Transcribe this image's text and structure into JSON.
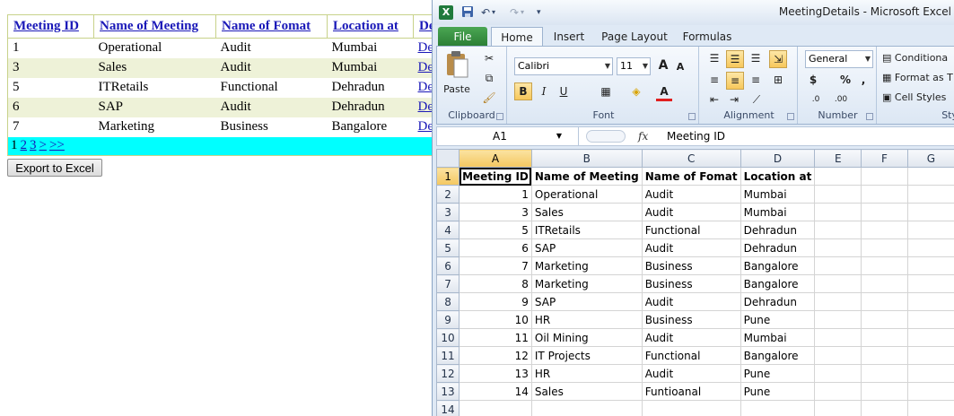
{
  "web": {
    "columns": [
      "Meeting ID",
      "Name of Meeting",
      "Name of Fomat",
      "Location at",
      "De"
    ],
    "rows": [
      {
        "id": "1",
        "name": "Operational",
        "format": "Audit",
        "location": "Mumbai",
        "more": "De"
      },
      {
        "id": "3",
        "name": "Sales",
        "format": "Audit",
        "location": "Mumbai",
        "more": "De"
      },
      {
        "id": "5",
        "name": "ITRetails",
        "format": "Functional",
        "location": "Dehradun",
        "more": "De"
      },
      {
        "id": "6",
        "name": "SAP",
        "format": "Audit",
        "location": "Dehradun",
        "more": "De"
      },
      {
        "id": "7",
        "name": "Marketing",
        "format": "Business",
        "location": "Bangalore",
        "more": "De"
      }
    ],
    "pager": {
      "current": "1",
      "pages": [
        "2",
        "3"
      ],
      "next": ">",
      "last": ">>"
    },
    "export_label": "Export to Excel"
  },
  "excel": {
    "window_title": "MeetingDetails  -  Microsoft Excel",
    "qat": {
      "save_icon": "save-icon",
      "undo_icon": "undo-icon",
      "redo_icon": "redo-icon"
    },
    "tabs": [
      "File",
      "Home",
      "Insert",
      "Page Layout",
      "Formulas"
    ],
    "ribbon": {
      "clipboard": {
        "label": "Clipboard",
        "paste": "Paste"
      },
      "font": {
        "label": "Font",
        "name": "Calibri",
        "size": "11",
        "bold": "B",
        "italic": "I",
        "underline": "U",
        "grow": "A",
        "shrink": "A"
      },
      "alignment": {
        "label": "Alignment"
      },
      "number": {
        "label": "Number",
        "format": "General",
        "currency": "$",
        "percent": "%",
        "comma": ",",
        "inc": ".0",
        "dec": ".00"
      },
      "styles": {
        "label": "Sty",
        "conditional": "Conditiona",
        "format_as": "Format as T",
        "cell_styles": "Cell Styles"
      }
    },
    "name_box": "A1",
    "fx": "fx",
    "formula": "Meeting ID",
    "col_headers": [
      "A",
      "B",
      "C",
      "D",
      "E",
      "F",
      "G"
    ],
    "header_row": [
      "Meeting ID",
      "Name of Meeting",
      "Name of Fomat",
      "Location at"
    ],
    "rows": [
      [
        "1",
        "Operational",
        "Audit",
        "Mumbai"
      ],
      [
        "3",
        "Sales",
        "Audit",
        "Mumbai"
      ],
      [
        "5",
        "ITRetails",
        "Functional",
        "Dehradun"
      ],
      [
        "6",
        "SAP",
        "Audit",
        "Dehradun"
      ],
      [
        "7",
        "Marketing",
        "Business",
        "Bangalore"
      ],
      [
        "8",
        "Marketing",
        "Business",
        "Bangalore"
      ],
      [
        "9",
        "SAP",
        "Audit",
        "Dehradun"
      ],
      [
        "10",
        "HR",
        "Business",
        "Pune"
      ],
      [
        "11",
        "Oil Mining",
        "Audit",
        "Mumbai"
      ],
      [
        "12",
        "IT Projects",
        "Functional",
        "Bangalore"
      ],
      [
        "13",
        "HR",
        "Audit",
        "Pune"
      ],
      [
        "14",
        "Sales",
        "Funtioanal",
        "Pune"
      ]
    ],
    "row_numbers": [
      "1",
      "2",
      "3",
      "4",
      "5",
      "6",
      "7",
      "8",
      "9",
      "10",
      "11",
      "12",
      "13",
      "14"
    ]
  }
}
